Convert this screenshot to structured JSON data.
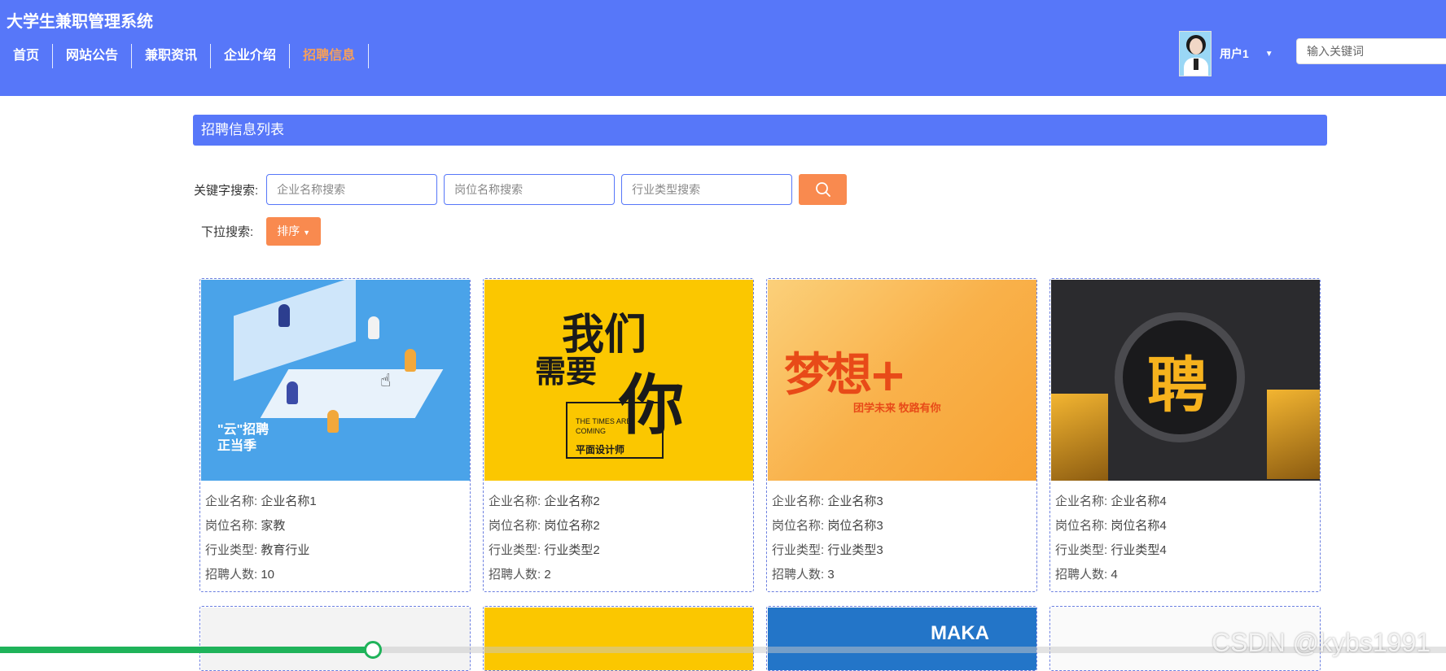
{
  "header": {
    "site_title": "大学生兼职管理系统",
    "nav": [
      {
        "label": "首页",
        "active": false
      },
      {
        "label": "网站公告",
        "active": false
      },
      {
        "label": "兼职资讯",
        "active": false
      },
      {
        "label": "企业介绍",
        "active": false
      },
      {
        "label": "招聘信息",
        "active": true
      }
    ],
    "user_name": "用户1",
    "search_placeholder": "输入关键词"
  },
  "section_title": "招聘信息列表",
  "search": {
    "label": "关键字搜索:",
    "company_placeholder": "企业名称搜索",
    "position_placeholder": "岗位名称搜索",
    "industry_placeholder": "行业类型搜索",
    "button_icon": "search-icon"
  },
  "dropdown": {
    "label": "下拉搜索:",
    "sort_label": "排序"
  },
  "field_labels": {
    "company": "企业名称:",
    "position": "岗位名称:",
    "industry": "行业类型:",
    "count": "招聘人数:"
  },
  "cards": [
    {
      "company": "企业名称1",
      "position": "家教",
      "industry": "教育行业",
      "count": "10",
      "image_text": [
        "\"云\"招聘",
        "正当季"
      ]
    },
    {
      "company": "企业名称2",
      "position": "岗位名称2",
      "industry": "行业类型2",
      "count": "2",
      "image_text": [
        "我们",
        "需要",
        "你",
        "THE TIMES ARE",
        "COMING",
        "平面设计师"
      ]
    },
    {
      "company": "企业名称3",
      "position": "岗位名称3",
      "industry": "行业类型3",
      "count": "3",
      "image_text": [
        "梦想+",
        "团学未来 牧路有你"
      ]
    },
    {
      "company": "企业名称4",
      "position": "岗位名称4",
      "industry": "行业类型4",
      "count": "4",
      "image_text": [
        "聘"
      ]
    }
  ],
  "bottom_cards_image_text": [
    "",
    "",
    "MAKA",
    ""
  ],
  "video": {
    "progress_fraction": 0.258,
    "watermark": "CSDN @kybs1991"
  },
  "colors": {
    "primary": "#5777f9",
    "accent": "#f98a4f",
    "active_nav": "#f7a05a",
    "progress": "#1fb35a"
  }
}
